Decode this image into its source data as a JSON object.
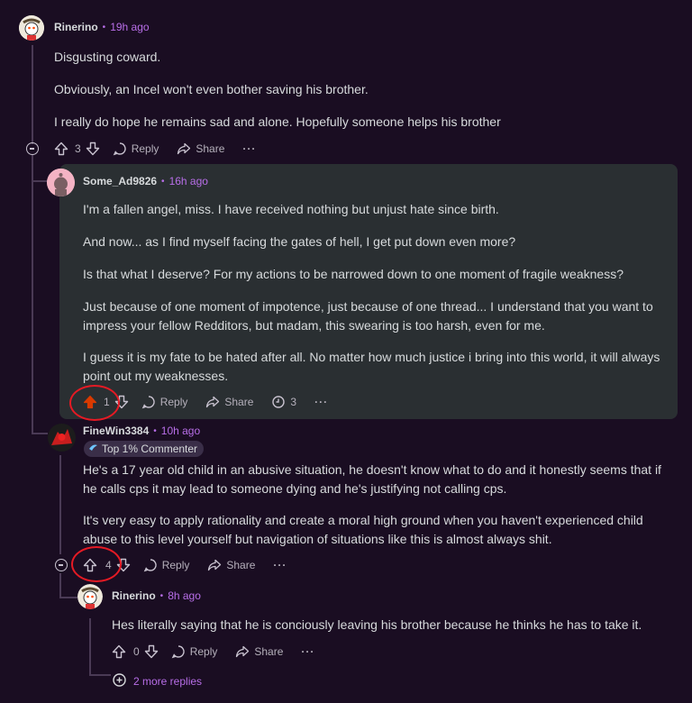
{
  "comments": [
    {
      "author": "Rinerino",
      "time": "19h ago",
      "paragraphs": [
        "Disgusting coward.",
        "Obviously, an Incel won't even bother saving his brother.",
        "I really do hope he remains sad and alone. Hopefully someone helps his brother"
      ],
      "votes": "3",
      "reply_label": "Reply",
      "share_label": "Share",
      "more_label": "···"
    },
    {
      "author": "Some_Ad9826",
      "time": "16h ago",
      "paragraphs": [
        "I'm a fallen angel, miss. I have received nothing but unjust hate since birth.",
        "And now... as I find myself facing the gates of hell, I get put down even more?",
        "Is that what I deserve? For my actions to be narrowed down to one moment of fragile weakness?",
        "Just because of one moment of impotence, just because of one thread... I understand that you want to impress your fellow Redditors, but madam, this swearing is too harsh, even for me.",
        "I guess it is my fate to be hated after all. No matter how much justice i bring into this world, it will always point out my weaknesses."
      ],
      "votes": "1",
      "reply_label": "Reply",
      "share_label": "Share",
      "awards": "3",
      "more_label": "···"
    },
    {
      "author": "FineWin3384",
      "time": "10h ago",
      "flair": "Top 1% Commenter",
      "paragraphs": [
        "He's a 17 year old child in an abusive situation, he doesn't know what to do and it honestly seems that if he calls cps it may lead to someone dying and he's justifying not calling cps.",
        "It's very easy to apply rationality and create a moral high ground when you haven't experienced child abuse to this level yourself but navigation of situations like this is almost always shit."
      ],
      "votes": "4",
      "reply_label": "Reply",
      "share_label": "Share",
      "more_label": "···"
    },
    {
      "author": "Rinerino",
      "time": "8h ago",
      "paragraphs": [
        "Hes literally saying that he is conciously leaving his brother because he thinks he has to take it."
      ],
      "votes": "0",
      "reply_label": "Reply",
      "share_label": "Share",
      "more_label": "···"
    }
  ],
  "more_replies_label": "2 more replies",
  "colors": {
    "background": "#1a0d22",
    "highlight": "#2a2f32",
    "timestamp": "#b86ee8",
    "upvoted": "#d93a00",
    "annotation": "#e51a24"
  }
}
